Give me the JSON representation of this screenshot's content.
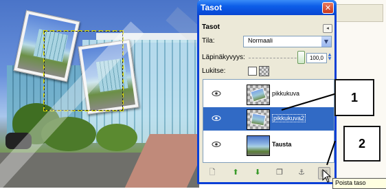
{
  "dialog": {
    "title": "Tasot",
    "close_icon": "close-icon",
    "panel_title": "Tasot",
    "mode_label": "Tila:",
    "mode_value": "Normaali",
    "opacity_label": "Läpinäkyvyys:",
    "opacity_value": "100,0",
    "lock_label": "Lukitse:",
    "layers": [
      {
        "name": "pikkukuva",
        "visible": true,
        "selected": false
      },
      {
        "name": "pikkukuva2",
        "visible": true,
        "selected": true
      },
      {
        "name": "Tausta",
        "visible": true,
        "selected": false
      }
    ],
    "toolbar_icons": [
      "new-layer-icon",
      "raise-layer-icon",
      "lower-layer-icon",
      "duplicate-layer-icon",
      "anchor-layer-icon",
      "delete-layer-icon"
    ]
  },
  "callouts": {
    "one": "1",
    "two": "2"
  },
  "tooltip": "Poista taso",
  "colors": {
    "titlebar": "#0d5ee8",
    "selected_row": "#316ac5",
    "panel_bg": "#ece9d8"
  }
}
